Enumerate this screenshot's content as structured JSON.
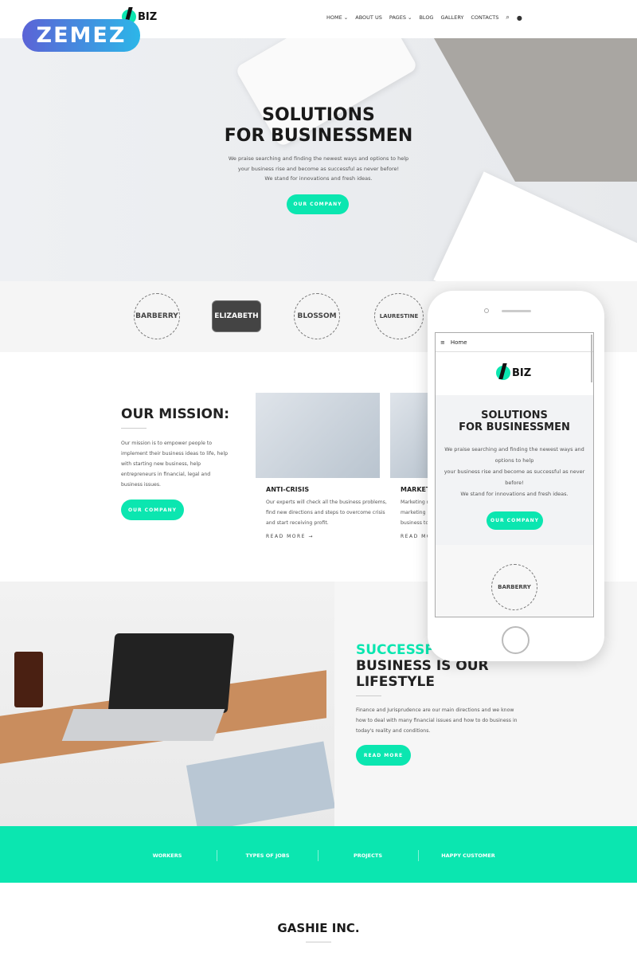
{
  "header": {
    "brand": "BIZ",
    "nav": [
      "HOME",
      "ABOUT US",
      "PAGES",
      "BLOG",
      "GALLERY",
      "CONTACTS"
    ],
    "icons": [
      "search-icon",
      "user-icon"
    ]
  },
  "watermark": "ZEMEZ",
  "hero": {
    "title_line1": "SOLUTIONS",
    "title_line2": "FOR BUSINESSMEN",
    "text": [
      "We praise searching and finding the newest ways and options to help",
      "your business rise and become as successful as never before!",
      "We stand for innovations and fresh ideas."
    ],
    "button": "OUR COMPANY"
  },
  "partners": [
    "BARBERRY",
    "ELIZABETH",
    "BLOSSOM",
    "LAURESTINE"
  ],
  "mission": {
    "title": "OUR MISSION:",
    "text": [
      "Our mission is to empower people to",
      "implement their business ideas to life, help",
      "with starting new business, help",
      "entrepreneurs in financial, legal and",
      "business issues."
    ],
    "button": "OUR COMPANY",
    "cards": [
      {
        "title": "ANTI-CRISIS",
        "text": [
          "Our experts will check all the business problems,",
          "find new directions and steps to overcome crisis",
          "and start receiving profit."
        ],
        "link": "READ MORE →"
      },
      {
        "title": "MARKET",
        "text": [
          "Marketing r",
          "marketing p",
          "business to"
        ],
        "link": "READ MOR"
      }
    ]
  },
  "lifestyle": {
    "title_accent": "SUCCESSFU",
    "title_line2": "BUSINESS IS OUR",
    "title_line3": "LIFESTYLE",
    "text": [
      "Finance and Jurisprudence are our main directions and we know",
      "how to deal with many financial issues and how to do business in",
      "today's reality and conditions."
    ],
    "button": "READ MORE"
  },
  "counters": [
    "WORKERS",
    "TYPES OF JOBS",
    "PROJECTS",
    "HAPPY CUSTOMER"
  ],
  "company": {
    "title": "GASHIE INC."
  },
  "phone": {
    "menu": "Home",
    "brand": "BIZ",
    "title_line1": "SOLUTIONS",
    "title_line2": "FOR BUSINESSMEN",
    "text": [
      "We praise searching and finding the newest ways and",
      "options to help",
      "your business rise and become as successful as never",
      "before!",
      "We stand for innovations and fresh ideas."
    ],
    "button": "OUR COMPANY",
    "badge": "BARBERRY"
  },
  "colors": {
    "accent": "#0be6b0"
  }
}
